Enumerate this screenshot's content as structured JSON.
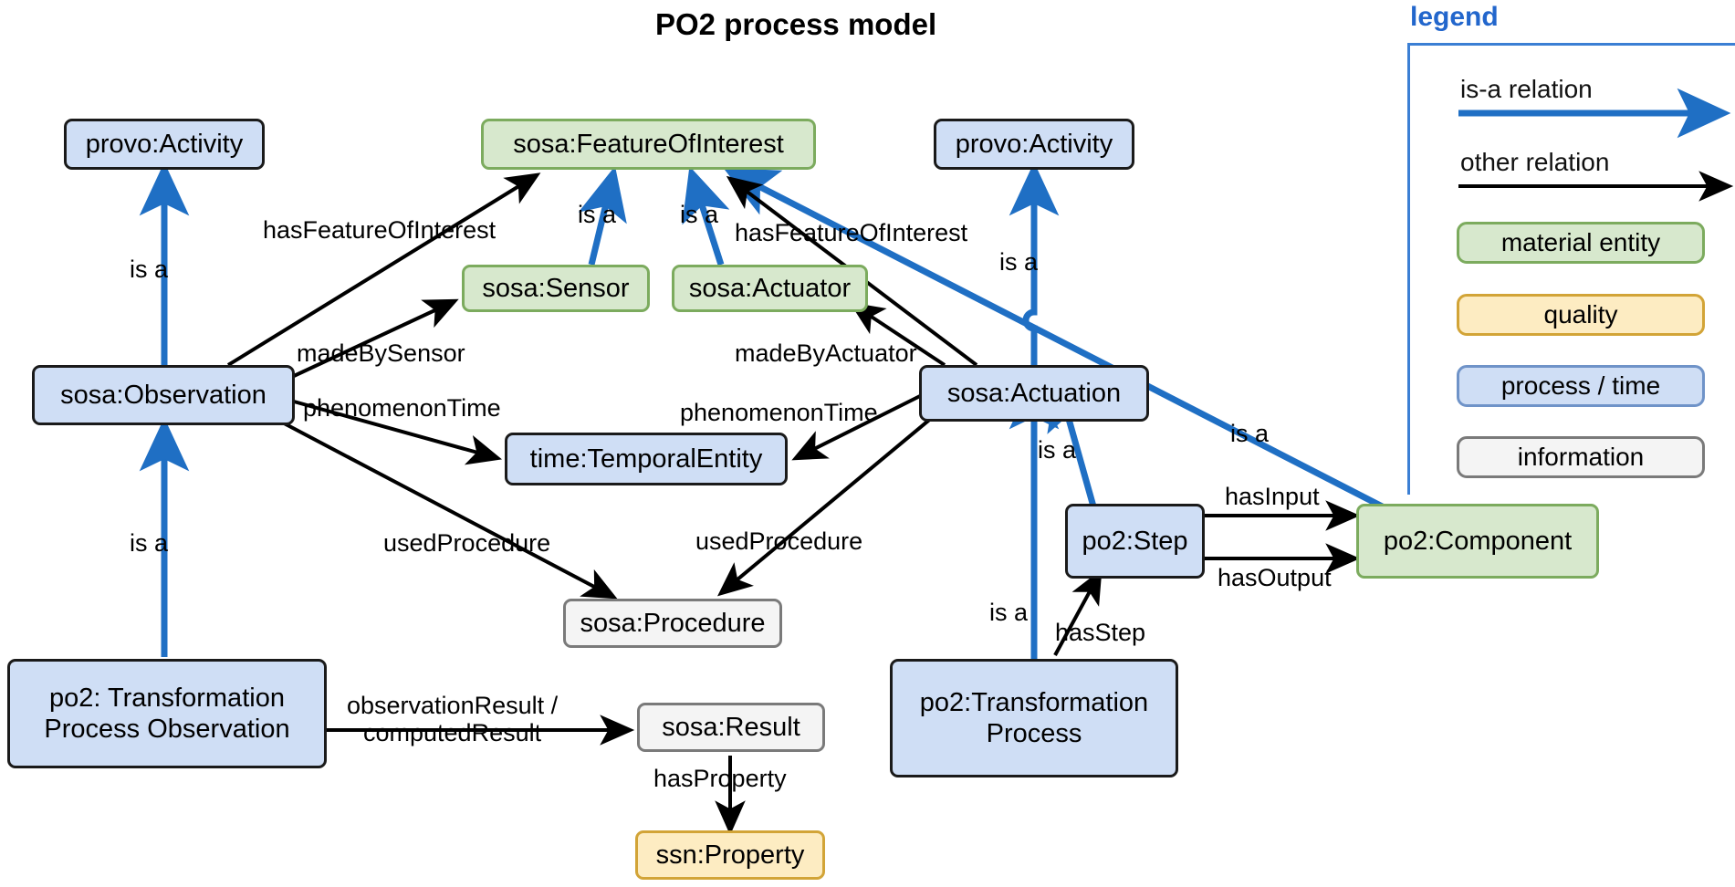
{
  "title": "PO2 process model",
  "colors": {
    "process_fill": "#cfdef5",
    "process_border": "#1a1a1a",
    "material_fill": "#d7e8cd",
    "material_border": "#7cab5e",
    "quality_fill": "#fdecc2",
    "quality_border": "#d2a437",
    "information_fill": "#f4f4f4",
    "information_border": "#7a7a7a",
    "isa_arrow": "#1f6fc4",
    "other_arrow": "#000000",
    "legend_accent": "#2266cc"
  },
  "nodes": [
    {
      "id": "provoActivityLeft",
      "label": "provo:Activity",
      "kind": "process"
    },
    {
      "id": "featureOfInterest",
      "label": "sosa:FeatureOfInterest",
      "kind": "material"
    },
    {
      "id": "provoActivityRight",
      "label": "provo:Activity",
      "kind": "process"
    },
    {
      "id": "sensor",
      "label": "sosa:Sensor",
      "kind": "material"
    },
    {
      "id": "actuator",
      "label": "sosa:Actuator",
      "kind": "material"
    },
    {
      "id": "observation",
      "label": "sosa:Observation",
      "kind": "process"
    },
    {
      "id": "actuation",
      "label": "sosa:Actuation",
      "kind": "process"
    },
    {
      "id": "temporalEntity",
      "label": "time:TemporalEntity",
      "kind": "process"
    },
    {
      "id": "step",
      "label": "po2:Step",
      "kind": "process"
    },
    {
      "id": "component",
      "label": "po2:Component",
      "kind": "material"
    },
    {
      "id": "procedure",
      "label": "sosa:Procedure",
      "kind": "information"
    },
    {
      "id": "transformObs",
      "label": "po2: Transformation\nProcess Observation",
      "kind": "process"
    },
    {
      "id": "transformProc",
      "label": "po2:Transformation\nProcess",
      "kind": "process"
    },
    {
      "id": "result",
      "label": "sosa:Result",
      "kind": "information"
    },
    {
      "id": "property",
      "label": "ssn:Property",
      "kind": "quality"
    }
  ],
  "edges": [
    {
      "id": "e1",
      "from": "observation",
      "to": "provoActivityLeft",
      "label": "is a",
      "type": "is-a"
    },
    {
      "id": "e2",
      "from": "transformObs",
      "to": "observation",
      "label": "is a",
      "type": "is-a"
    },
    {
      "id": "e3",
      "from": "observation",
      "to": "featureOfInterest",
      "label": "hasFeatureOfInterest",
      "type": "other"
    },
    {
      "id": "e4",
      "from": "observation",
      "to": "sensor",
      "label": "madeBySensor",
      "type": "other"
    },
    {
      "id": "e5",
      "from": "observation",
      "to": "temporalEntity",
      "label": "phenomenonTime",
      "type": "other"
    },
    {
      "id": "e6",
      "from": "observation",
      "to": "procedure",
      "label": "usedProcedure",
      "type": "other"
    },
    {
      "id": "e7",
      "from": "sensor",
      "to": "featureOfInterest",
      "label": "is a",
      "type": "is-a"
    },
    {
      "id": "e8",
      "from": "actuator",
      "to": "featureOfInterest",
      "label": "is a",
      "type": "is-a"
    },
    {
      "id": "e9",
      "from": "actuation",
      "to": "featureOfInterest",
      "label": "hasFeatureOfInterest",
      "type": "other"
    },
    {
      "id": "e10",
      "from": "actuation",
      "to": "actuator",
      "label": "madeByActuator",
      "type": "other"
    },
    {
      "id": "e11",
      "from": "actuation",
      "to": "temporalEntity",
      "label": "phenomenonTime",
      "type": "other"
    },
    {
      "id": "e12",
      "from": "actuation",
      "to": "procedure",
      "label": "usedProcedure",
      "type": "other"
    },
    {
      "id": "e13",
      "from": "actuation",
      "to": "provoActivityRight",
      "label": "is a",
      "type": "is-a"
    },
    {
      "id": "e14",
      "from": "component",
      "to": "featureOfInterest",
      "label": "is a",
      "type": "is-a"
    },
    {
      "id": "e15",
      "from": "step",
      "to": "actuation",
      "label": "is a",
      "type": "is-a"
    },
    {
      "id": "e16",
      "from": "transformProc",
      "to": "actuation",
      "label": "is a",
      "type": "is-a"
    },
    {
      "id": "e17",
      "from": "transformProc",
      "to": "step",
      "label": "hasStep",
      "type": "other"
    },
    {
      "id": "e18",
      "from": "step",
      "to": "component",
      "label": "hasInput",
      "type": "other"
    },
    {
      "id": "e19",
      "from": "step",
      "to": "component",
      "label": "hasOutput",
      "type": "other"
    },
    {
      "id": "e20",
      "from": "transformObs",
      "to": "result",
      "label": "observationResult /\ncomputedResult",
      "type": "other"
    },
    {
      "id": "e21",
      "from": "result",
      "to": "property",
      "label": "hasProperty",
      "type": "other"
    }
  ],
  "edge_labels": [
    {
      "id": "l_isa_left",
      "text": "is a"
    },
    {
      "id": "l_isa_left2",
      "text": "is a"
    },
    {
      "id": "l_hasFOI_left",
      "text": "hasFeatureOfInterest"
    },
    {
      "id": "l_madeBySensor",
      "text": "madeBySensor"
    },
    {
      "id": "l_phenTimeLeft",
      "text": "phenomenonTime"
    },
    {
      "id": "l_usedProcLeft",
      "text": "usedProcedure"
    },
    {
      "id": "l_isaSensor",
      "text": "is a"
    },
    {
      "id": "l_isaActuator",
      "text": "is a"
    },
    {
      "id": "l_hasFOI_right",
      "text": "hasFeatureOfInterest"
    },
    {
      "id": "l_madeByActuator",
      "text": "madeByActuator"
    },
    {
      "id": "l_phenTimeRight",
      "text": "phenomenonTime"
    },
    {
      "id": "l_usedProcRight",
      "text": "usedProcedure"
    },
    {
      "id": "l_isaActuation",
      "text": "is a"
    },
    {
      "id": "l_isaComponent",
      "text": "is a"
    },
    {
      "id": "l_isaStep",
      "text": "is a"
    },
    {
      "id": "l_isaTransform",
      "text": "is a"
    },
    {
      "id": "l_hasStep",
      "text": "hasStep"
    },
    {
      "id": "l_hasInput",
      "text": "hasInput"
    },
    {
      "id": "l_hasOutput",
      "text": "hasOutput"
    },
    {
      "id": "l_obsResult",
      "text": "observationResult /\ncomputedResult"
    },
    {
      "id": "l_hasProperty",
      "text": "hasProperty"
    }
  ],
  "legend": {
    "title": "legend",
    "relations": [
      {
        "id": "isa",
        "label": "is-a relation",
        "color": "#1f6fc4"
      },
      {
        "id": "other",
        "label": "other relation",
        "color": "#000000"
      }
    ],
    "chips": [
      {
        "id": "material",
        "label": "material entity",
        "kind": "material"
      },
      {
        "id": "quality",
        "label": "quality",
        "kind": "quality"
      },
      {
        "id": "process",
        "label": "process / time",
        "kind": "process"
      },
      {
        "id": "information",
        "label": "information",
        "kind": "information"
      }
    ]
  }
}
